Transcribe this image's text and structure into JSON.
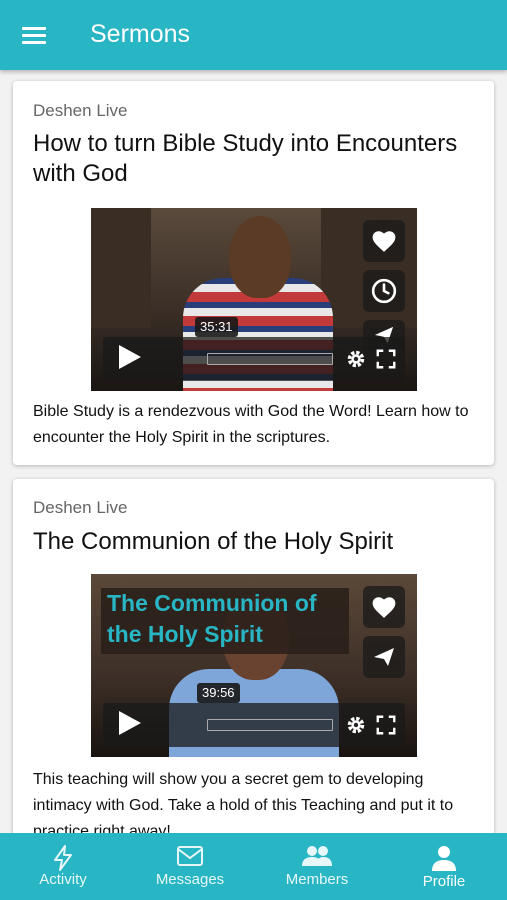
{
  "app_bar": {
    "title": "Sermons",
    "menu_icon": "hamburger-menu-icon"
  },
  "colors": {
    "primary": "#28b5c4",
    "card_bg": "#ffffff",
    "overlay_title": "#28b5c4"
  },
  "sermons": [
    {
      "source": "Deshen Live",
      "title": "How to turn Bible Study into Encounters with God",
      "duration": "35:31",
      "description": "Bible Study is a rendezvous with God the Word! Learn how to encounter the Holy Spirit in the scriptures.",
      "actions": [
        "heart-icon",
        "clock-icon",
        "send-icon"
      ]
    },
    {
      "source": "Deshen Live",
      "title": "The Communion of the Holy Spirit",
      "duration": "39:56",
      "overlay_title": "The Communion of the Holy Spirit",
      "description": "This teaching will show you a secret gem to developing intimacy with God. Take a hold of this Teaching and put it to practice right away!",
      "actions": [
        "heart-icon",
        "send-icon"
      ]
    }
  ],
  "bottom_nav": {
    "tabs": [
      {
        "label": "Activity",
        "icon": "lightning-icon"
      },
      {
        "label": "Messages",
        "icon": "mail-icon"
      },
      {
        "label": "Members",
        "icon": "people-icon"
      },
      {
        "label": "Profile",
        "icon": "person-icon",
        "active": true
      }
    ]
  }
}
